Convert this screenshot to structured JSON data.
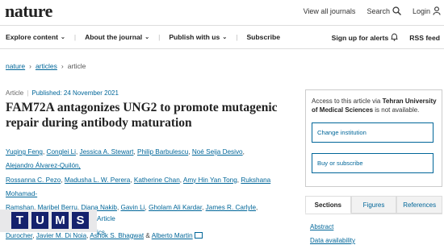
{
  "header": {
    "logo": "nature",
    "view_journals": "View all journals",
    "search": "Search",
    "login": "Login"
  },
  "nav": {
    "explore": "Explore content",
    "about": "About the journal",
    "publish": "Publish with us",
    "subscribe": "Subscribe",
    "alerts": "Sign up for alerts",
    "rss": "RSS feed"
  },
  "breadcrumb": {
    "items": [
      "nature",
      "articles",
      "article"
    ]
  },
  "article": {
    "type": "Article",
    "published": "Published: 24 November 2021",
    "title": "FAM72A antagonizes UNG2 to promote mutagenic repair during antibody maturation",
    "authors_lines": [
      [
        "Yuqing Feng",
        "Conglei Li",
        "Jessica A. Stewart",
        "Philip Barbulescu",
        "Noé Seija Desivo",
        "Alejandro Álvarez-Quilón,"
      ],
      [
        "Rossanna C. Pezo",
        "Madusha L. W. Perera",
        "Katherine Chan",
        "Amy Hin Yan Tong",
        "Rukshana Mohamad-"
      ],
      [
        "Ramshan",
        "Maribel Berru",
        "Diana Nakib",
        "Gavin Li",
        "Gholam Ali Kardar",
        "James R. Carlyle",
        "Jason Moffat",
        "Daniel"
      ],
      [
        "Durocher",
        "Javier M. Di Noia",
        "Ashok S. Bhagwat",
        "Alberto Martin"
      ]
    ],
    "extra_links": [
      "Article",
      "ics"
    ]
  },
  "banner": {
    "letters": [
      "T",
      "U",
      "M",
      "S"
    ]
  },
  "access": {
    "text_prefix": "Access to this article via ",
    "institution": "Tehran University of Medical Sciences",
    "text_suffix": " is not available.",
    "change_button": "Change institution",
    "buy_button": "Buy or subscribe"
  },
  "tabs": {
    "items": [
      "Sections",
      "Figures",
      "References"
    ],
    "active": 0
  },
  "sections": {
    "links": [
      "Abstract",
      "Data availability"
    ]
  },
  "colors": {
    "link": "#006699",
    "banner": "#15226d"
  }
}
